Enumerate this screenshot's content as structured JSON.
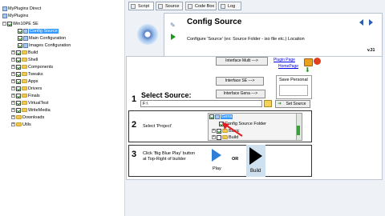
{
  "tree": {
    "items": [
      {
        "label": "MyPlugins Direct"
      },
      {
        "label": "MyPlugins"
      },
      {
        "label": "Win10PE SE"
      },
      {
        "label": "Config Source"
      },
      {
        "label": "Main Configuration"
      },
      {
        "label": "Images Configuration"
      },
      {
        "label": "Build"
      },
      {
        "label": "Shell"
      },
      {
        "label": "Components"
      },
      {
        "label": "Tweaks"
      },
      {
        "label": "Apps"
      },
      {
        "label": "Drivers"
      },
      {
        "label": "Finals"
      },
      {
        "label": "VirtualTest"
      },
      {
        "label": "WriteMedia"
      },
      {
        "label": "Downloads"
      },
      {
        "label": "Utils"
      }
    ]
  },
  "tabs": [
    {
      "label": "Script"
    },
    {
      "label": "Source"
    },
    {
      "label": "Code Box"
    },
    {
      "label": "Log"
    }
  ],
  "header": {
    "title": "Config Source",
    "description": "Configure 'Source' (ex: Source Folder - iso file etc.) Location",
    "version": "v.31"
  },
  "interface": {
    "multi_label": "Interface Multi --->",
    "se_label": "Interface SE --->",
    "gena_label": "Interface Gena --->",
    "plugin_page": "Plugin Page",
    "home_page": "HomePage",
    "save_personal": "Save Personal"
  },
  "steps": {
    "s1_num": "1",
    "s1_title": "Select Source:",
    "s1_value": "F:\\",
    "s1_button": "Set Source",
    "s2_num": "2",
    "s2_text": "Select 'Project'",
    "s2_tree": [
      "Gena",
      "Config Source Folder",
      "Basic",
      "Build"
    ],
    "s3_num": "3",
    "s3_text_1": "Click 'Big Blue Play' button",
    "s3_text_2": "at Top-Right of builder",
    "play_label": "Play",
    "or_label": "OR",
    "build_label": "Build"
  }
}
